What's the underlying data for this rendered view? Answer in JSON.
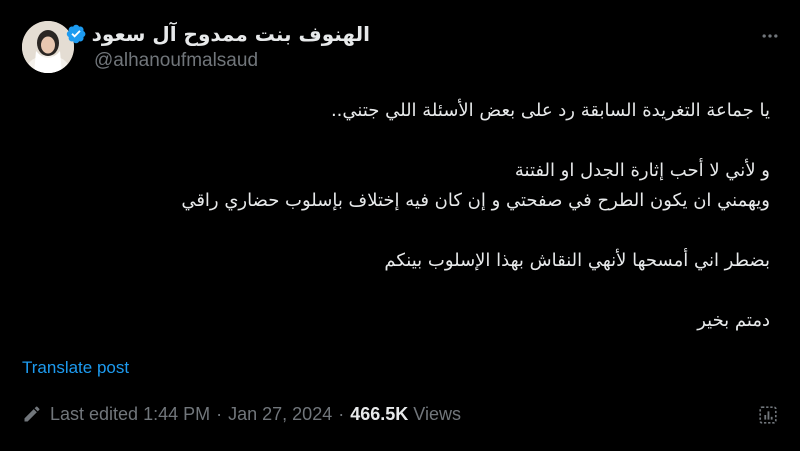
{
  "author": {
    "display_name": "الهنوف بنت ممدوح آل سعود",
    "handle": "@alhanoufmalsaud",
    "verified": true,
    "verified_icon": "verified-badge-icon",
    "verified_color": "#1d9bf0"
  },
  "post": {
    "lines": [
      "يا جماعة التغريدة السابقة رد على بعض الأسئلة اللي جتني..",
      "",
      "و لأني لا أحب إثارة الجدل او الفتنة",
      "ويهمني ان يكون الطرح في صفحتي و إن كان فيه إختلاف بإسلوب حضاري راقي",
      "",
      "بضطر اني أمسحها لأنهي النقاش بهذا الإسلوب بينكم",
      "",
      "دمتم بخير"
    ],
    "translate_label": "Translate post"
  },
  "meta": {
    "edited_label": "Last edited",
    "time": "1:44 PM",
    "separator": "·",
    "date": "Jan 27, 2024",
    "views_count": "466.5K",
    "views_label": "Views"
  },
  "icons": {
    "more": "more-horizontal-icon",
    "edit": "pencil-icon",
    "analytics": "analytics-icon"
  },
  "colors": {
    "background": "#000000",
    "text": "#e7e9ea",
    "secondary": "#71767b",
    "link": "#1d9bf0"
  }
}
